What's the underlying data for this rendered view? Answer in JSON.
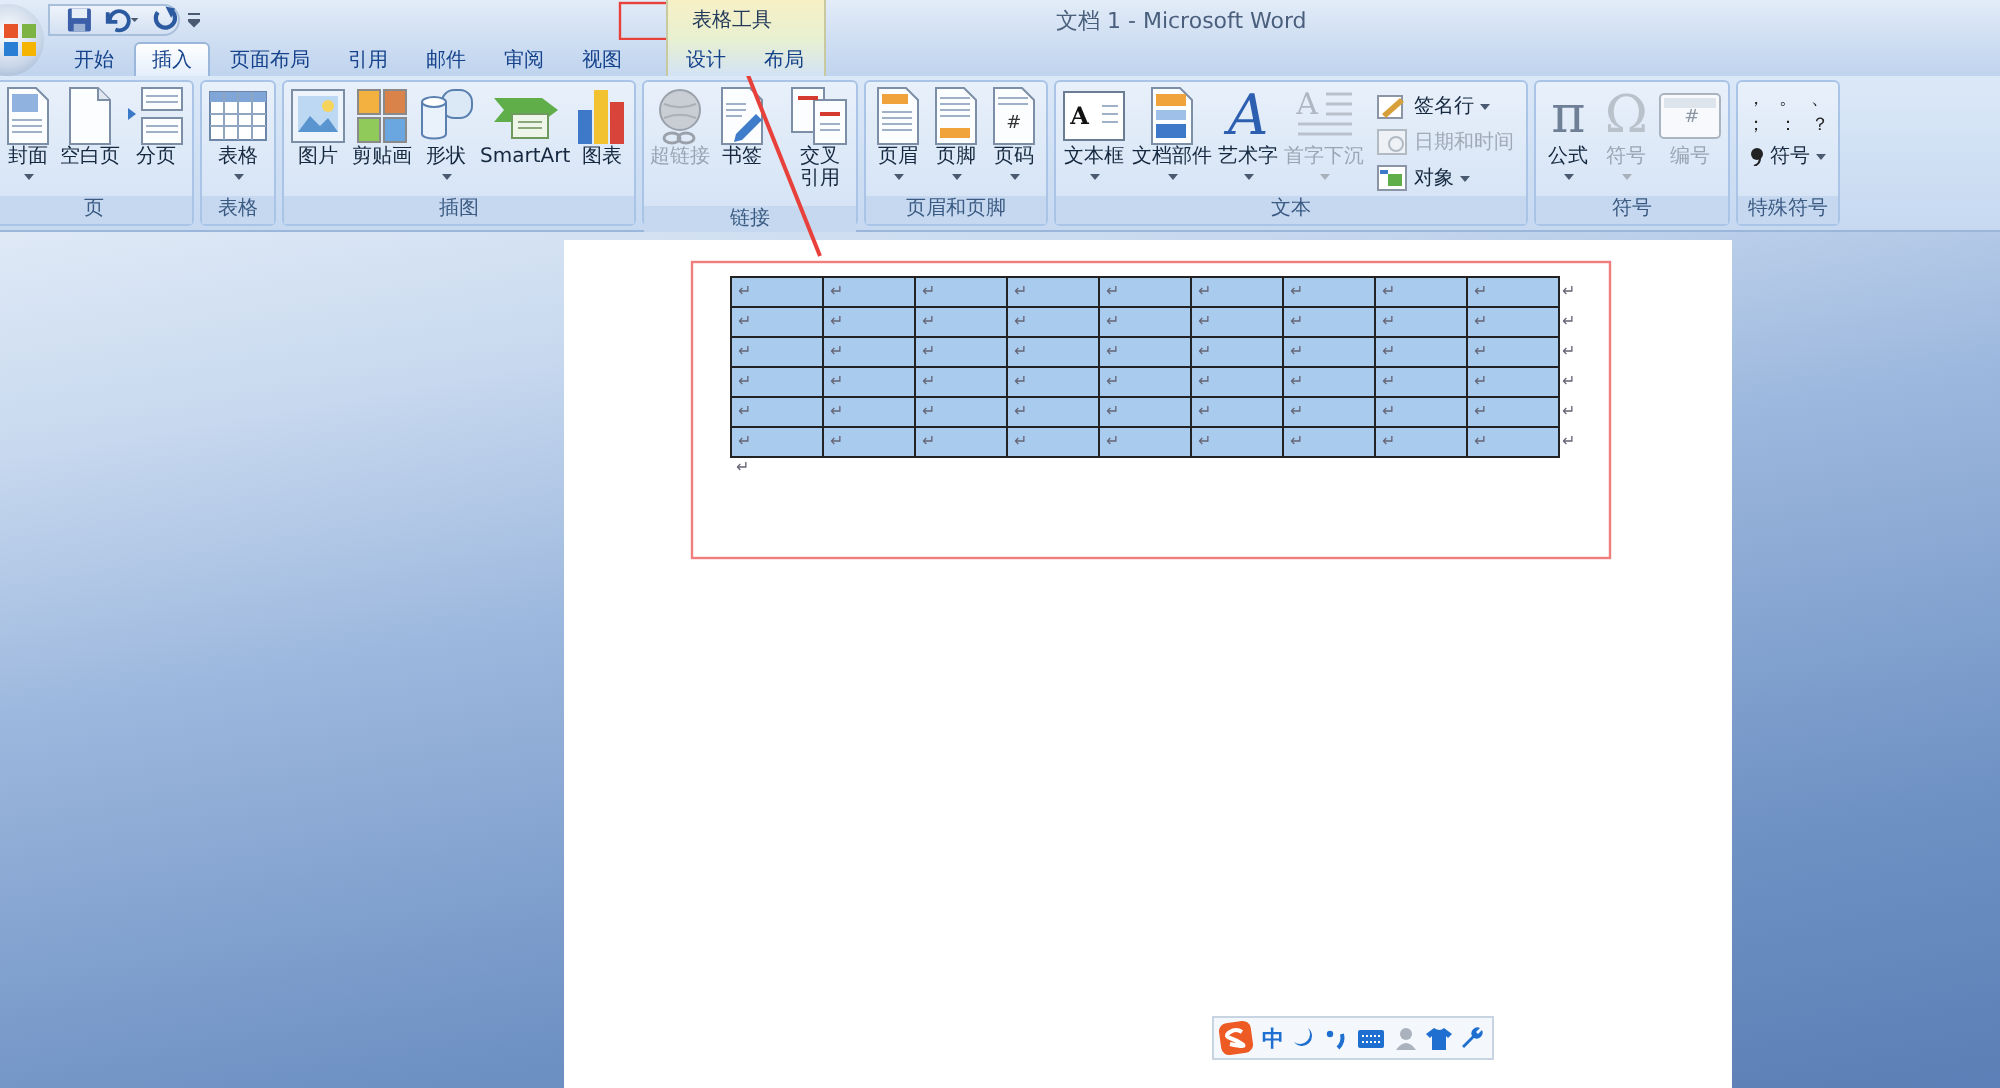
{
  "window": {
    "title": "文档 1 - Microsoft Word"
  },
  "tabs": [
    {
      "label": "开始",
      "selected": false
    },
    {
      "label": "插入",
      "selected": true
    },
    {
      "label": "页面布局",
      "selected": false
    },
    {
      "label": "引用",
      "selected": false
    },
    {
      "label": "邮件",
      "selected": false
    },
    {
      "label": "审阅",
      "selected": false
    },
    {
      "label": "视图",
      "selected": false
    }
  ],
  "contextual_tab_group": {
    "label": "表格工具",
    "tabs": [
      {
        "label": "设计",
        "selected": false
      },
      {
        "label": "布局",
        "selected": false
      }
    ]
  },
  "ribbon_groups": [
    {
      "label": "页",
      "buttons": [
        {
          "label": "封面",
          "disabled": false,
          "dropdown": true
        },
        {
          "label": "空白页",
          "disabled": false,
          "dropdown": false
        },
        {
          "label": "分页",
          "disabled": false,
          "dropdown": false
        }
      ]
    },
    {
      "label": "表格",
      "buttons": [
        {
          "label": "表格",
          "disabled": false,
          "dropdown": true
        }
      ]
    },
    {
      "label": "插图",
      "buttons": [
        {
          "label": "图片",
          "disabled": false,
          "dropdown": false
        },
        {
          "label": "剪贴画",
          "disabled": false,
          "dropdown": false
        },
        {
          "label": "形状",
          "disabled": false,
          "dropdown": true
        },
        {
          "label": "SmartArt",
          "disabled": false,
          "dropdown": false
        },
        {
          "label": "图表",
          "disabled": false,
          "dropdown": false
        }
      ]
    },
    {
      "label": "链接",
      "buttons": [
        {
          "label": "超链接",
          "disabled": true,
          "dropdown": false
        },
        {
          "label": "书签",
          "disabled": false,
          "dropdown": false
        },
        {
          "label": "交叉引用",
          "disabled": false,
          "dropdown": false
        }
      ]
    },
    {
      "label": "页眉和页脚",
      "buttons": [
        {
          "label": "页眉",
          "disabled": false,
          "dropdown": true
        },
        {
          "label": "页脚",
          "disabled": false,
          "dropdown": true
        },
        {
          "label": "页码",
          "disabled": false,
          "dropdown": true,
          "glyph": "#"
        }
      ]
    },
    {
      "label": "文本",
      "buttons": [
        {
          "label": "文本框",
          "disabled": false,
          "dropdown": true,
          "glyph": "A"
        },
        {
          "label": "文档部件",
          "disabled": false,
          "dropdown": true
        },
        {
          "label": "艺术字",
          "disabled": false,
          "dropdown": true,
          "glyph": "A"
        },
        {
          "label": "首字下沉",
          "disabled": true,
          "dropdown": true,
          "glyph": "A"
        }
      ],
      "small_buttons": [
        {
          "label": "签名行",
          "disabled": false,
          "dropdown": true
        },
        {
          "label": "日期和时间",
          "disabled": true,
          "dropdown": false
        },
        {
          "label": "对象",
          "disabled": false,
          "dropdown": true
        }
      ]
    },
    {
      "label": "符号",
      "buttons": [
        {
          "label": "公式",
          "disabled": false,
          "dropdown": true,
          "glyph": "π"
        },
        {
          "label": "符号",
          "disabled": true,
          "dropdown": true,
          "glyph": "Ω"
        },
        {
          "label": "编号",
          "disabled": true,
          "dropdown": false,
          "glyph": "#"
        }
      ]
    },
    {
      "label": "特殊符号",
      "symbols": [
        "，",
        "。",
        "、",
        "；",
        "：",
        "？"
      ],
      "small_buttons": [
        {
          "label": "符号",
          "disabled": false,
          "dropdown": true
        }
      ]
    }
  ],
  "document": {
    "table": {
      "selected": true,
      "rows": [
        {
          "cells": [
            "↵",
            "↵",
            "↵",
            "↵",
            "↵",
            "↵",
            "↵",
            "↵",
            "↵"
          ],
          "end_mark": "↵"
        },
        {
          "cells": [
            "↵",
            "↵",
            "↵",
            "↵",
            "↵",
            "↵",
            "↵",
            "↵",
            "↵"
          ],
          "end_mark": "↵"
        },
        {
          "cells": [
            "↵",
            "↵",
            "↵",
            "↵",
            "↵",
            "↵",
            "↵",
            "↵",
            "↵"
          ],
          "end_mark": "↵"
        },
        {
          "cells": [
            "↵",
            "↵",
            "↵",
            "↵",
            "↵",
            "↵",
            "↵",
            "↵",
            "↵"
          ],
          "end_mark": "↵"
        },
        {
          "cells": [
            "↵",
            "↵",
            "↵",
            "↵",
            "↵",
            "↵",
            "↵",
            "↵",
            "↵"
          ],
          "end_mark": "↵"
        },
        {
          "cells": [
            "↵",
            "↵",
            "↵",
            "↵",
            "↵",
            "↵",
            "↵",
            "↵",
            "↵"
          ],
          "end_mark": "↵"
        }
      ]
    },
    "paragraph_mark": "↵"
  },
  "ime_toolbar": {
    "mode": "中"
  }
}
